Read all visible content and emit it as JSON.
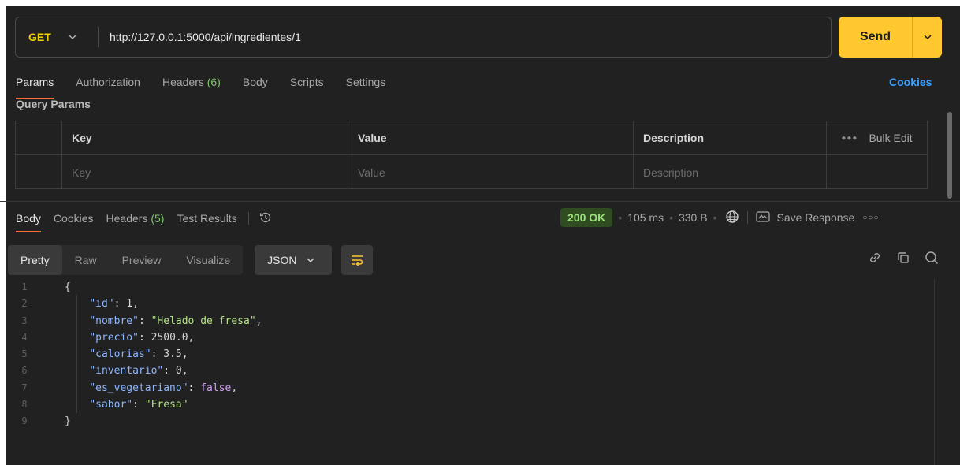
{
  "request": {
    "method": "GET",
    "url": "http://127.0.0.1:5000/api/ingredientes/1",
    "send_label": "Send"
  },
  "request_tabs": [
    {
      "label": "Params",
      "count": ""
    },
    {
      "label": "Authorization",
      "count": ""
    },
    {
      "label": "Headers",
      "count": "(6)"
    },
    {
      "label": "Body",
      "count": ""
    },
    {
      "label": "Scripts",
      "count": ""
    },
    {
      "label": "Settings",
      "count": ""
    }
  ],
  "cookies_link": "Cookies",
  "query_params": {
    "title": "Query Params",
    "headers": {
      "key": "Key",
      "value": "Value",
      "description": "Description",
      "bulk_edit": "Bulk Edit"
    },
    "placeholders": {
      "key": "Key",
      "value": "Value",
      "description": "Description"
    }
  },
  "response_tabs": [
    {
      "label": "Body",
      "count": ""
    },
    {
      "label": "Cookies",
      "count": ""
    },
    {
      "label": "Headers",
      "count": "(5)"
    },
    {
      "label": "Test Results",
      "count": ""
    }
  ],
  "response_meta": {
    "status": "200 OK",
    "time": "105 ms",
    "size": "330 B",
    "save_response": "Save Response"
  },
  "format_tabs": [
    "Pretty",
    "Raw",
    "Preview",
    "Visualize"
  ],
  "format_select": "JSON",
  "code_lines": [
    {
      "n": "1",
      "tokens": [
        {
          "t": "p",
          "v": "{"
        }
      ]
    },
    {
      "n": "2",
      "tokens": [
        {
          "t": "p",
          "v": "    "
        },
        {
          "t": "k",
          "v": "\"id\""
        },
        {
          "t": "p",
          "v": ": "
        },
        {
          "t": "n",
          "v": "1"
        },
        {
          "t": "p",
          "v": ","
        }
      ]
    },
    {
      "n": "3",
      "tokens": [
        {
          "t": "p",
          "v": "    "
        },
        {
          "t": "k",
          "v": "\"nombre\""
        },
        {
          "t": "p",
          "v": ": "
        },
        {
          "t": "s",
          "v": "\"Helado de fresa\""
        },
        {
          "t": "p",
          "v": ","
        }
      ]
    },
    {
      "n": "4",
      "tokens": [
        {
          "t": "p",
          "v": "    "
        },
        {
          "t": "k",
          "v": "\"precio\""
        },
        {
          "t": "p",
          "v": ": "
        },
        {
          "t": "n",
          "v": "2500.0"
        },
        {
          "t": "p",
          "v": ","
        }
      ]
    },
    {
      "n": "5",
      "tokens": [
        {
          "t": "p",
          "v": "    "
        },
        {
          "t": "k",
          "v": "\"calorias\""
        },
        {
          "t": "p",
          "v": ": "
        },
        {
          "t": "n",
          "v": "3.5"
        },
        {
          "t": "p",
          "v": ","
        }
      ]
    },
    {
      "n": "6",
      "tokens": [
        {
          "t": "p",
          "v": "    "
        },
        {
          "t": "k",
          "v": "\"inventario\""
        },
        {
          "t": "p",
          "v": ": "
        },
        {
          "t": "n",
          "v": "0"
        },
        {
          "t": "p",
          "v": ","
        }
      ]
    },
    {
      "n": "7",
      "tokens": [
        {
          "t": "p",
          "v": "    "
        },
        {
          "t": "k",
          "v": "\"es_vegetariano\""
        },
        {
          "t": "p",
          "v": ": "
        },
        {
          "t": "b",
          "v": "false"
        },
        {
          "t": "p",
          "v": ","
        }
      ]
    },
    {
      "n": "8",
      "tokens": [
        {
          "t": "p",
          "v": "    "
        },
        {
          "t": "k",
          "v": "\"sabor\""
        },
        {
          "t": "p",
          "v": ": "
        },
        {
          "t": "s",
          "v": "\"Fresa\""
        }
      ]
    },
    {
      "n": "9",
      "tokens": [
        {
          "t": "p",
          "v": "}"
        }
      ]
    }
  ],
  "colors": {
    "accent_orange": "#ff6c37",
    "send_yellow": "#ffc82e",
    "method_yellow": "#f0d200",
    "status_green": "#9be27c",
    "link_blue": "#3aa0ff",
    "json_key": "#8db6ff",
    "json_string": "#b5e28a",
    "json_bool": "#d49bff"
  },
  "icons": [
    "chevron-down-icon",
    "history-icon",
    "globe-icon",
    "save-response-icon",
    "more-icon",
    "wrap-lines-icon",
    "link-icon",
    "copy-icon",
    "search-icon"
  ]
}
